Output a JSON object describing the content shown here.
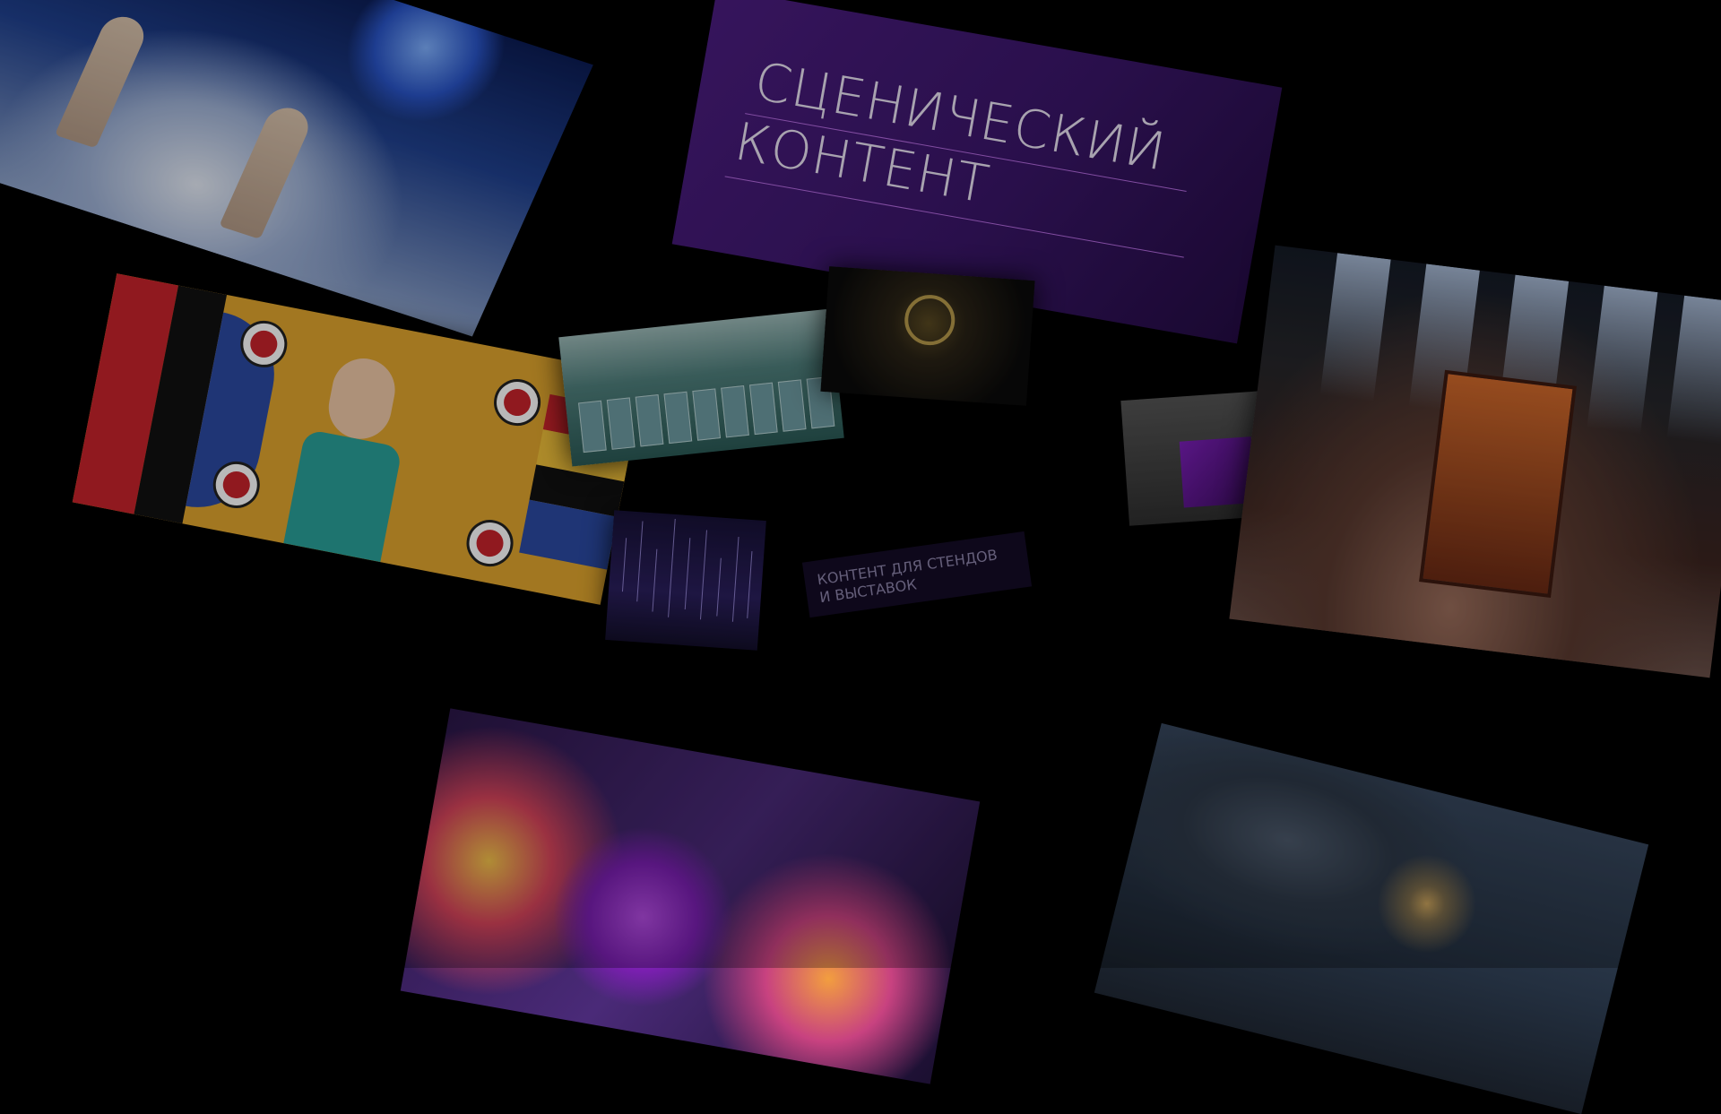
{
  "title": {
    "line1": "СЦЕНИЧЕСКИЙ",
    "line2": "КОНТЕНТ"
  },
  "caption": {
    "line1": "КОНТЕНТ ДЛЯ СТЕНДОВ",
    "line2": "И ВЫСТАВОК"
  },
  "colors": {
    "background": "#000000",
    "title_panel": "#4b1d80",
    "accent_line": "#b46be0",
    "title_text": "#e9e2f3"
  }
}
